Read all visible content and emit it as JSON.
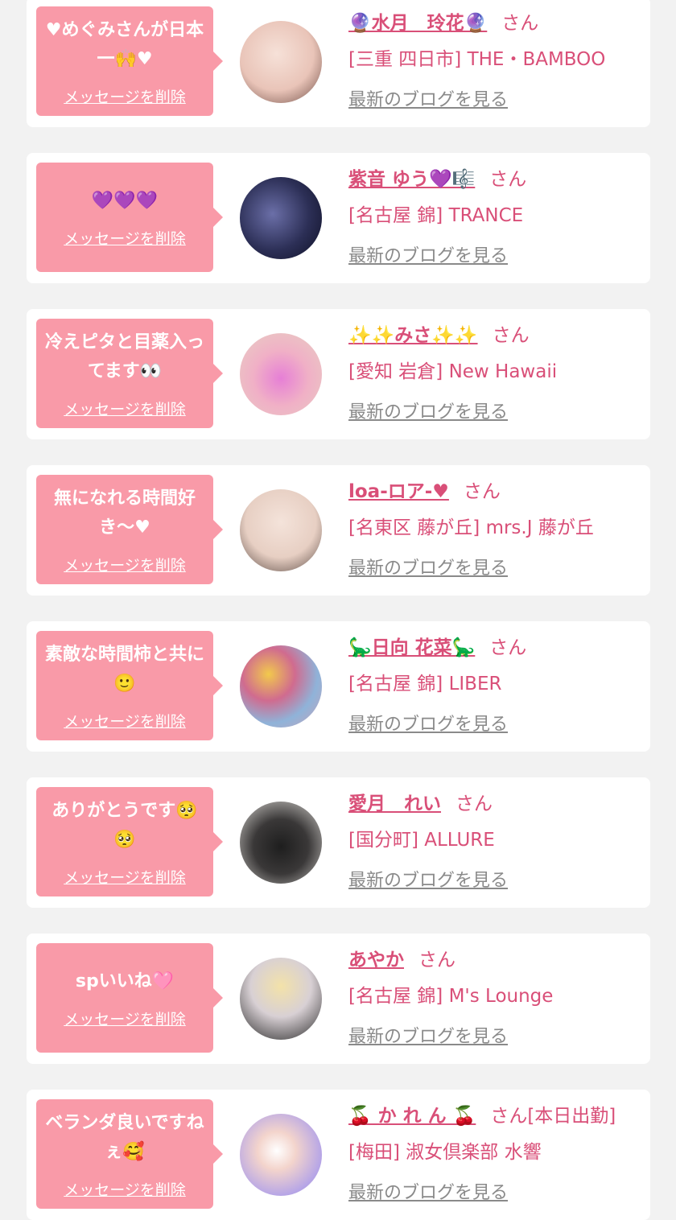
{
  "cards": [
    {
      "message": "♥めぐみさんが日本一🙌♥",
      "delete_label": "メッセージを削除",
      "name": "🔮水月　玲花🔮",
      "suffix": "さん",
      "shop": "[三重 四日市] THE・BAMBOO",
      "blog_label": "最新のブログを見る",
      "avatar_color": "#e9c4b8"
    },
    {
      "message": "💜💜💜",
      "delete_label": "メッセージを削除",
      "name": "紫音 ゆう💜🎼",
      "suffix": "さん",
      "shop": "[名古屋 錦] TRANCE",
      "blog_label": "最新のブログを見る",
      "avatar_color": "#2c2f56"
    },
    {
      "message": "冷えピタと目薬入ってます👀",
      "delete_label": "メッセージを削除",
      "name": "✨✨みさ✨✨",
      "suffix": "さん",
      "shop": "[愛知 岩倉] New Hawaii",
      "blog_label": "最新のブログを見る",
      "avatar_color": "#f0b0c6"
    },
    {
      "message": "無になれる時間好き〜♥",
      "delete_label": "メッセージを削除",
      "name": "loa-ロア-♥",
      "suffix": "さん",
      "shop": "[名東区 藤が丘] mrs.J 藤が丘",
      "blog_label": "最新のブログを見る",
      "avatar_color": "#e7cfc3"
    },
    {
      "message": "素敵な時間柿と共に🙂",
      "delete_label": "メッセージを削除",
      "name": "🦕日向 花菜🦕",
      "suffix": "さん",
      "shop": "[名古屋 錦] LIBER",
      "blog_label": "最新のブログを見る",
      "avatar_color": "#c9a3b8"
    },
    {
      "message": "ありがとうです🥺🥺",
      "delete_label": "メッセージを削除",
      "name": "愛月　れい",
      "suffix": "さん",
      "shop": "[国分町] ALLURE",
      "blog_label": "最新のブログを見る",
      "avatar_color": "#3a3838"
    },
    {
      "message": "spいいね🩷",
      "delete_label": "メッセージを削除",
      "name": "あやか",
      "suffix": "さん",
      "shop": "[名古屋 錦] M's Lounge",
      "blog_label": "最新のブログを見る",
      "avatar_color": "#d8d0d4"
    },
    {
      "message": "ベランダ良いですねぇ🥰",
      "delete_label": "メッセージを削除",
      "name": "🍒 か れ ん 🍒",
      "suffix": "さん[本日出勤]",
      "shop": "[梅田] 淑女倶楽部 水響",
      "blog_label": "最新のブログを見る",
      "avatar_color": "#b7a6e6"
    }
  ]
}
